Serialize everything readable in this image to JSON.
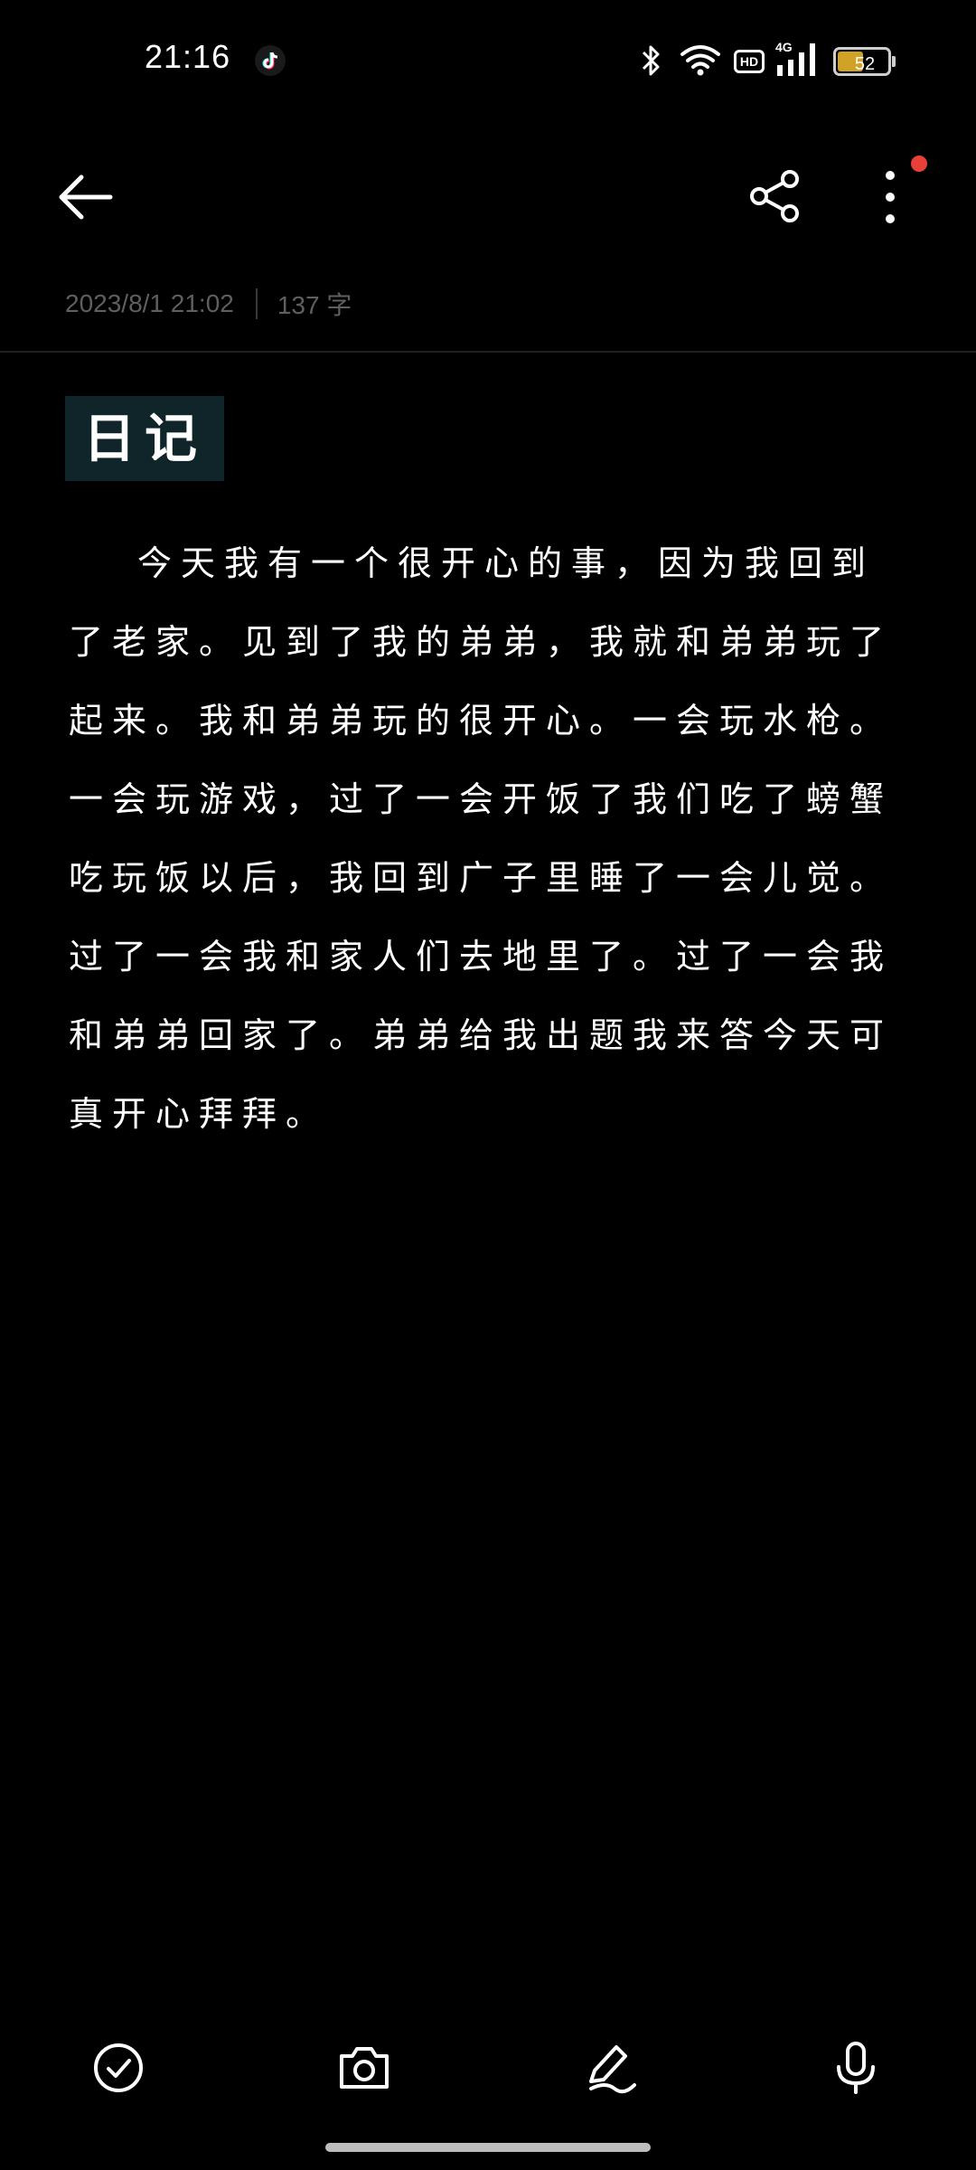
{
  "status_bar": {
    "time": "21:16",
    "hd_label": "HD",
    "network_label": "4G",
    "battery_level": "52",
    "battery_fraction": 0.52,
    "icons": [
      "tiktok-icon",
      "bluetooth-icon",
      "wifi-icon",
      "hd-icon",
      "signal-icon",
      "battery-icon"
    ]
  },
  "toolbar": {
    "icons": [
      "back-arrow-icon",
      "share-icon",
      "more-vertical-icon"
    ],
    "notification_dot_color": "#e84038"
  },
  "note": {
    "date": "2023/8/1 21:02",
    "word_count": "137 字",
    "title": "日记",
    "body": "今天我有一个很开心的事，因为我回到了老家。见到了我的弟弟，我就和弟弟玩了起来。我和弟弟玩的很开心。一会玩水枪。一会玩游戏，过了一会开饭了我们吃了螃蟹吃玩饭以后，我回到广子里睡了一会儿觉。过了一会我和家人们去地里了。过了一会我和弟弟回家了。弟弟给我出题我来答今天可真开心拜拜。"
  },
  "bottom_toolbar": {
    "icons": [
      "checklist-icon",
      "camera-icon",
      "handwriting-icon",
      "microphone-icon"
    ]
  },
  "colors": {
    "background": "#000000",
    "title_highlight": "#0f2529",
    "meta_text": "#5f5f5f",
    "battery_fill": "#d0a326"
  }
}
